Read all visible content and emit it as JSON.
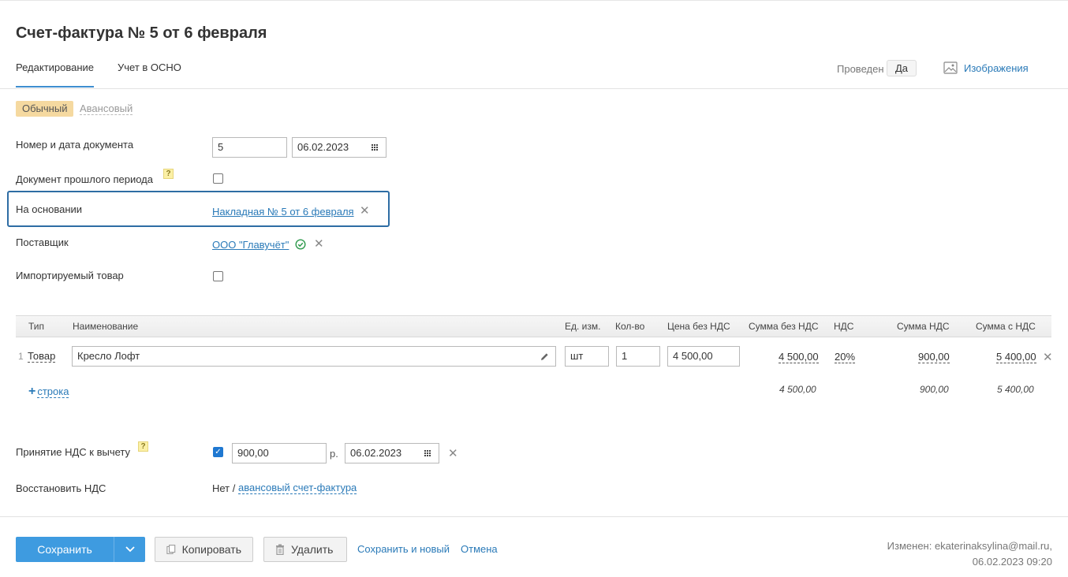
{
  "header": {
    "title": "Счет-фактура № 5 от 6 февраля",
    "tabs": [
      {
        "label": "Редактирование"
      },
      {
        "label": "Учет в ОСНО"
      }
    ],
    "posted_label": "Проведен",
    "posted_value": "Да",
    "images_link": "Изображения"
  },
  "type_switch": {
    "active": "Обычный",
    "inactive": "Авансовый"
  },
  "form": {
    "number_date_label": "Номер и дата документа",
    "number_value": "5",
    "date_value": "06.02.2023",
    "prev_period_label": "Документ прошлого периода",
    "help_mark": "?",
    "basis_label": "На основании",
    "basis_link": "Накладная № 5 от 6 февраля",
    "supplier_label": "Поставщик",
    "supplier_link": "ООО \"Главучёт\"",
    "imported_label": "Импортируемый товар"
  },
  "table": {
    "headers": {
      "type": "Тип",
      "name": "Наименование",
      "unit": "Ед. изм.",
      "qty": "Кол-во",
      "price": "Цена без НДС",
      "sum_no_vat": "Сумма без НДС",
      "vat": "НДС",
      "vat_sum": "Сумма НДС",
      "sum_with_vat": "Сумма с НДС"
    },
    "rows": [
      {
        "num": "1",
        "type": "Товар",
        "name": "Кресло Лофт",
        "unit": "шт",
        "qty": "1",
        "price": "4 500,00",
        "sum_no_vat": "4 500,00",
        "vat": "20%",
        "vat_sum": "900,00",
        "sum_with_vat": "5 400,00"
      }
    ],
    "add_row": "строка",
    "totals": {
      "sum_no_vat": "4 500,00",
      "vat_sum": "900,00",
      "sum_with_vat": "5 400,00"
    }
  },
  "vat": {
    "deduction_label": "Принятие НДС к вычету",
    "deduction_amount": "900,00",
    "currency": "р.",
    "deduction_date": "06.02.2023",
    "restore_label": "Восстановить НДС",
    "restore_value": "Нет /",
    "restore_link": "авансовый счет-фактура"
  },
  "footer": {
    "save": "Сохранить",
    "copy": "Копировать",
    "delete": "Удалить",
    "save_new": "Сохранить и новый",
    "cancel": "Отмена",
    "modified_line1": "Изменен: ekaterinaksylina@mail.ru,",
    "modified_line2": "06.02.2023 09:20"
  },
  "colors": {
    "accent": "#3e9be0",
    "link": "#2a7ab8",
    "active_pill": "#f5d9a0",
    "highlight": "#2e6da4"
  }
}
